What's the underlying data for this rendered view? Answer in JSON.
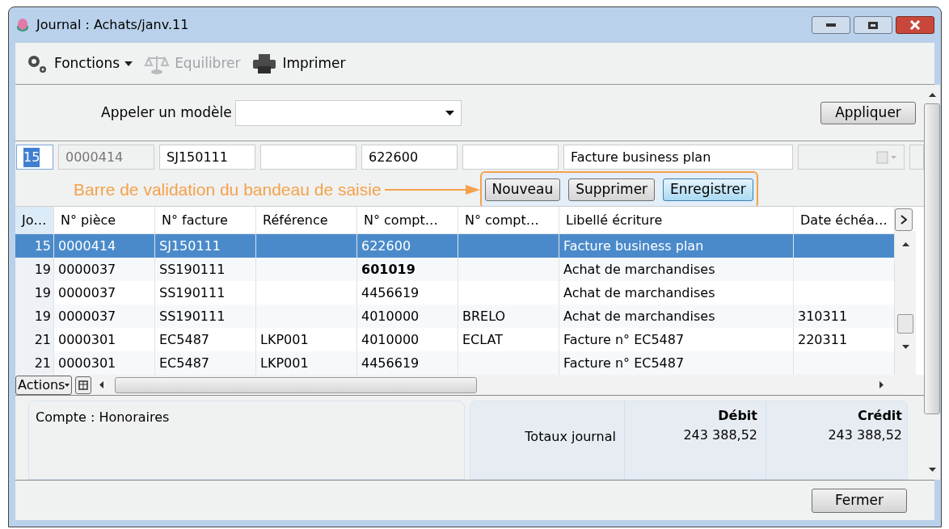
{
  "window": {
    "title": "Journal : Achats/janv.11"
  },
  "toolbar": [
    {
      "kind": "menu",
      "label": "Fonctions",
      "disabled": false
    },
    {
      "kind": "balance",
      "label": "Equilibrer",
      "disabled": true
    },
    {
      "kind": "print",
      "label": "Imprimer",
      "disabled": false
    }
  ],
  "model": {
    "label": "Appeler un modèle",
    "button": "Appliquer"
  },
  "entry_fields": [
    {
      "value": "15",
      "kind": "selected"
    },
    {
      "value": "0000414",
      "kind": "readonly"
    },
    {
      "value": "SJ150111",
      "kind": "text"
    },
    {
      "kind": "text"
    },
    {
      "value": "622600",
      "kind": "text"
    },
    {
      "kind": "text"
    },
    {
      "value": "Facture business plan",
      "kind": "wide"
    },
    {
      "kind": "date"
    },
    {
      "kind": "cut"
    }
  ],
  "annotation": "Barre de validation du bandeau de saisie",
  "validation_buttons": [
    {
      "label": "Nouveau",
      "focused": false
    },
    {
      "label": "Supprimer",
      "focused": false
    },
    {
      "label": "Enregistrer",
      "focused": true
    }
  ],
  "table": {
    "columns": [
      "Jo…",
      "N° pièce",
      "N° facture",
      "Référence",
      "N° compt…",
      "N° compt…",
      "Libellé écriture",
      "Date échéa…"
    ],
    "rows": [
      {
        "selected": true,
        "cells": [
          "15",
          "0000414",
          "SJ150111",
          "",
          "622600",
          "",
          "Facture business plan",
          ""
        ]
      },
      {
        "selected": false,
        "cells": [
          "19",
          "0000037",
          "SS190111",
          "",
          {
            "text": "601019",
            "bold": true
          },
          "",
          "Achat de marchandises",
          ""
        ]
      },
      {
        "selected": false,
        "cells": [
          "19",
          "0000037",
          "SS190111",
          "",
          "4456619",
          "",
          "Achat de marchandises",
          ""
        ]
      },
      {
        "selected": false,
        "cells": [
          "19",
          "0000037",
          "SS190111",
          "",
          "4010000",
          "BRELO",
          "Achat de marchandises",
          "310311"
        ]
      },
      {
        "selected": false,
        "cells": [
          "21",
          "0000301",
          "EC5487",
          "LKP001",
          "4010000",
          "ECLAT",
          "Facture n° EC5487",
          "220311"
        ]
      },
      {
        "selected": false,
        "cells": [
          "21",
          "0000301",
          "EC5487",
          "LKP001",
          "4456619",
          "",
          "Facture n° EC5487",
          ""
        ]
      }
    ],
    "actions_button": "Actions"
  },
  "account": "Compte : Honoraires",
  "totals": {
    "headers": [
      "Débit",
      "Crédit"
    ],
    "label": "Totaux journal",
    "debit": "243 388,52",
    "credit": "243 388,52"
  },
  "close_button": "Fermer"
}
